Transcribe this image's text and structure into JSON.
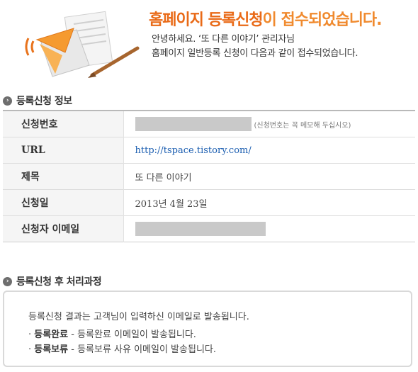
{
  "header": {
    "headline_main": "홈페이지 등록신청",
    "headline_rest": "이 접수되었습니다.",
    "greeting_line1": "안녕하세요. ‘또 다른 이야기’ 관리자님",
    "greeting_line2": "홈페이지 일반등록 신청이 다음과 같이 접수되었습니다."
  },
  "info_section": {
    "title": "등록신청 정보",
    "rows": [
      {
        "label": "신청번호",
        "value": "",
        "note": "(신청번호는 꼭 메모해 두십시오)"
      },
      {
        "label": "URL",
        "value": "http://tspace.tistory.com/"
      },
      {
        "label": "제목",
        "value": "또 다른 이야기"
      },
      {
        "label": "신청일",
        "value": "2013년 4월 23일"
      },
      {
        "label": "신청자 이메일",
        "value": ""
      }
    ]
  },
  "process_section": {
    "title": "등록신청 후 처리과정",
    "intro": "등록신청 결과는 고객님이 입력하신 이메일로 발송됩니다.",
    "items": [
      {
        "status": "등록완료",
        "desc": " - 등록완료 이메일이 발송됩니다."
      },
      {
        "status": "등록보류",
        "desc": " - 등록보류 사유 이메일이 발송됩니다."
      }
    ]
  },
  "icons": {
    "illustration": "envelope-document-pen-icon",
    "section_bullet": "circle-arrow-icon"
  },
  "colors": {
    "headline": "#f08a2e",
    "link": "#1a5db0",
    "redacted": "#c9c9c9"
  }
}
